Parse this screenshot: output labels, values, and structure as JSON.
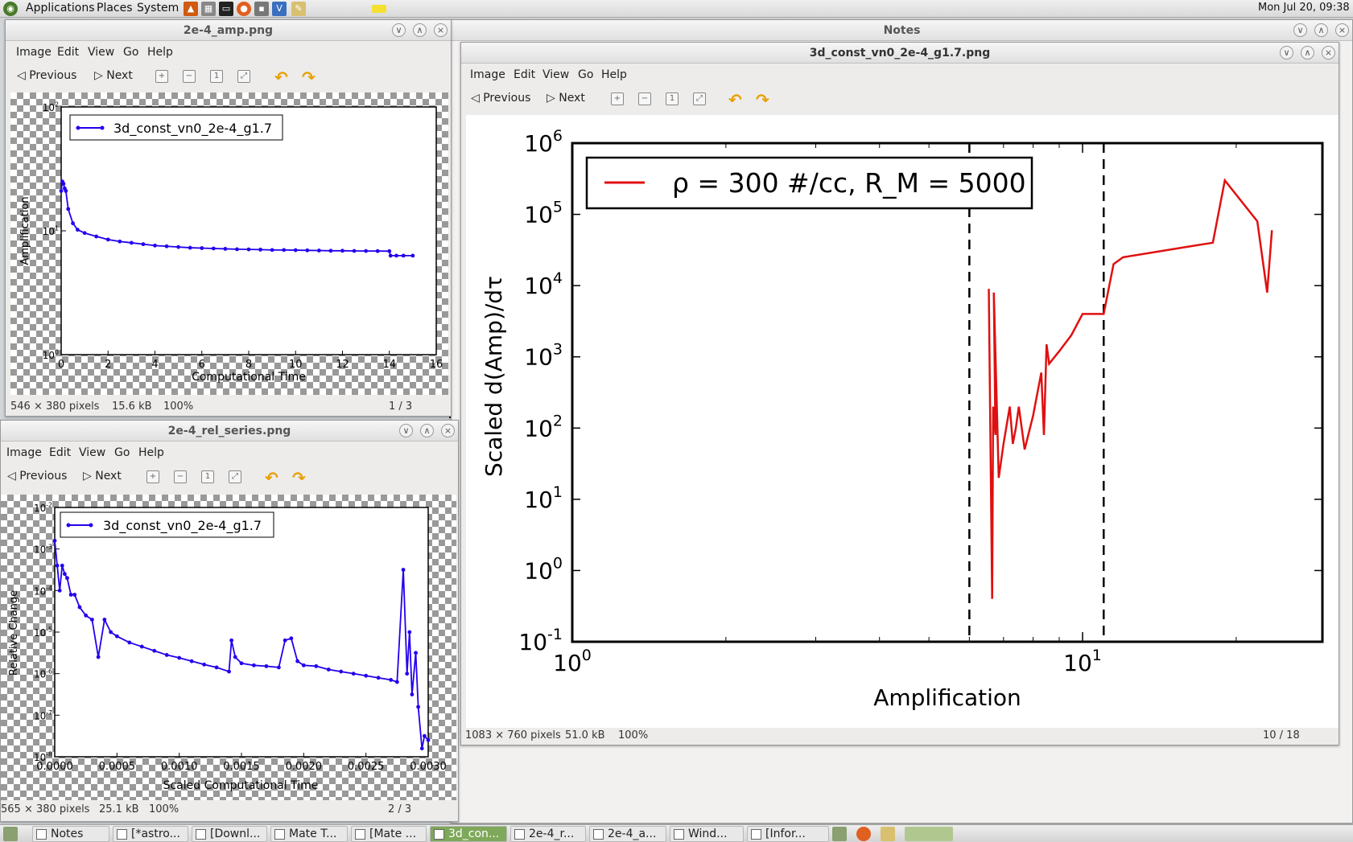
{
  "topbar": {
    "applications": "Applications",
    "places": "Places",
    "system": "System",
    "clock": "Mon Jul 20, 09:38"
  },
  "notes_window": {
    "title": "Notes"
  },
  "viewer_common": {
    "menu": [
      "Image",
      "Edit",
      "View",
      "Go",
      "Help"
    ],
    "previous": "Previous",
    "next": "Next"
  },
  "win_amp": {
    "title": "2e-4_amp.png",
    "status_size": "546 × 380 pixels",
    "status_filesize": "15.6 kB",
    "status_zoom": "100%",
    "status_count": "1 / 3",
    "chart_data": {
      "type": "line",
      "xlabel": "Computational Time",
      "ylabel": "Amplification",
      "y_scale": "log",
      "xlim": [
        0,
        16
      ],
      "ylim_exp": [
        0,
        2
      ],
      "x_ticks": [
        "0",
        "2",
        "4",
        "6",
        "8",
        "10",
        "12",
        "14",
        "16"
      ],
      "legend": "3d_const_vn0_2e-4_g1.7",
      "series_color": "#2200ee",
      "x": [
        0.0,
        0.05,
        0.1,
        0.15,
        0.2,
        0.3,
        0.5,
        0.7,
        1,
        1.5,
        2,
        2.5,
        3,
        3.5,
        4,
        4.5,
        5,
        5.5,
        6,
        6.5,
        7,
        7.5,
        8,
        8.5,
        9,
        9.5,
        10,
        10.5,
        11,
        11.5,
        12,
        12.5,
        13,
        13.5,
        14,
        14.05,
        14.3,
        14.6,
        15
      ],
      "y": [
        21,
        25,
        24,
        22,
        21,
        15,
        11.5,
        10.2,
        9.6,
        9.0,
        8.5,
        8.2,
        8.0,
        7.8,
        7.6,
        7.5,
        7.4,
        7.3,
        7.25,
        7.2,
        7.15,
        7.1,
        7.08,
        7.05,
        7.0,
        7.0,
        6.98,
        6.95,
        6.93,
        6.9,
        6.9,
        6.88,
        6.87,
        6.86,
        6.85,
        6.3,
        6.3,
        6.3,
        6.3
      ]
    }
  },
  "win_rel": {
    "title": "2e-4_rel_series.png",
    "status_size": "565 × 380 pixels",
    "status_filesize": "25.1 kB",
    "status_zoom": "100%",
    "status_count": "2 / 3",
    "chart_data": {
      "type": "line",
      "xlabel": "Scaled Computational Time",
      "ylabel": "Relative Change",
      "y_scale": "log",
      "xlim": [
        0,
        0.003
      ],
      "ylim_exp": [
        -8,
        -2
      ],
      "x_ticks": [
        "0.0000",
        "0.0005",
        "0.0010",
        "0.0015",
        "0.0020",
        "0.0025",
        "0.0030"
      ],
      "legend": "3d_const_vn0_2e-4_g1.7",
      "series_color": "#2200ee",
      "x": [
        0.0,
        2e-05,
        4e-05,
        6e-05,
        8e-05,
        0.0001,
        0.00013,
        0.00016,
        0.0002,
        0.00025,
        0.0003,
        0.00035,
        0.0004,
        0.00045,
        0.0005,
        0.0006,
        0.0007,
        0.0008,
        0.0009,
        0.001,
        0.0011,
        0.0012,
        0.0013,
        0.0014,
        0.00142,
        0.00145,
        0.0015,
        0.0016,
        0.0017,
        0.0018,
        0.00185,
        0.0019,
        0.00195,
        0.002,
        0.0021,
        0.0022,
        0.0023,
        0.0024,
        0.0025,
        0.0026,
        0.0027,
        0.00275,
        0.0028,
        0.00283,
        0.00285,
        0.00287,
        0.0029,
        0.00292,
        0.00295,
        0.00297,
        0.003
      ],
      "y": [
        -2.8,
        -3.4,
        -4.0,
        -3.4,
        -3.6,
        -3.7,
        -4.1,
        -4.1,
        -4.4,
        -4.6,
        -4.7,
        -5.6,
        -4.7,
        -5.0,
        -5.1,
        -5.25,
        -5.35,
        -5.45,
        -5.55,
        -5.62,
        -5.7,
        -5.78,
        -5.85,
        -5.95,
        -5.2,
        -5.6,
        -5.75,
        -5.8,
        -5.82,
        -5.85,
        -5.2,
        -5.15,
        -5.7,
        -5.8,
        -5.82,
        -5.9,
        -5.95,
        -6.0,
        -6.05,
        -6.1,
        -6.15,
        -6.2,
        -3.5,
        -6.0,
        -5.0,
        -6.5,
        -5.5,
        -6.8,
        -7.8,
        -7.5,
        -7.6
      ]
    }
  },
  "win_main": {
    "title": "3d_const_vn0_2e-4_g1.7.png",
    "status_size": "1083 × 760 pixels",
    "status_filesize": "51.0 kB",
    "status_zoom": "100%",
    "status_count": "10 / 18",
    "chart_data": {
      "type": "line",
      "xlabel": "Amplification",
      "ylabel": "Scaled d(Amp)/dτ",
      "x_scale": "log",
      "y_scale": "log",
      "xlim_exp": [
        0,
        1.47
      ],
      "ylim_exp": [
        -1,
        6
      ],
      "x_ticks": [
        {
          "base": "10",
          "exp": "0"
        },
        {
          "base": "10",
          "exp": "1"
        }
      ],
      "y_ticks": [
        {
          "base": "10",
          "exp": "-1"
        },
        {
          "base": "10",
          "exp": "0"
        },
        {
          "base": "10",
          "exp": "1"
        },
        {
          "base": "10",
          "exp": "2"
        },
        {
          "base": "10",
          "exp": "3"
        },
        {
          "base": "10",
          "exp": "4"
        },
        {
          "base": "10",
          "exp": "5"
        },
        {
          "base": "10",
          "exp": "6"
        }
      ],
      "legend": "ρ =  300 #/cc, R_M = 5000",
      "series_color": "#e01010",
      "vlines_x": [
        6.0,
        11.0
      ],
      "x": [
        6.55,
        6.65,
        6.68,
        6.75,
        6.7,
        6.85,
        7.0,
        7.2,
        7.3,
        7.4,
        7.5,
        7.7,
        8.0,
        8.3,
        8.4,
        8.5,
        8.6,
        9.0,
        9.5,
        10.0,
        11.0,
        11.5,
        12.0,
        16.0,
        18.0,
        19.0,
        22.0,
        23.0,
        23.5
      ],
      "y": [
        9000,
        0.4,
        200,
        80,
        8000,
        20,
        60,
        200,
        60,
        100,
        200,
        50,
        150,
        600,
        80,
        1500,
        800,
        1200,
        2000,
        4000,
        4000,
        20000,
        25000,
        35000,
        40000,
        300000,
        80000,
        8000,
        60000
      ]
    }
  },
  "taskbar": {
    "tasks": [
      {
        "label": "Notes",
        "active": false
      },
      {
        "label": "[*astro...",
        "active": false
      },
      {
        "label": "[Downl...",
        "active": false
      },
      {
        "label": "Mate T...",
        "active": false
      },
      {
        "label": "[Mate ...",
        "active": false
      },
      {
        "label": "3d_con...",
        "active": true
      },
      {
        "label": "2e-4_r...",
        "active": false
      },
      {
        "label": "2e-4_a...",
        "active": false
      },
      {
        "label": "Wind...",
        "active": false
      },
      {
        "label": "[Infor...",
        "active": false
      }
    ]
  }
}
